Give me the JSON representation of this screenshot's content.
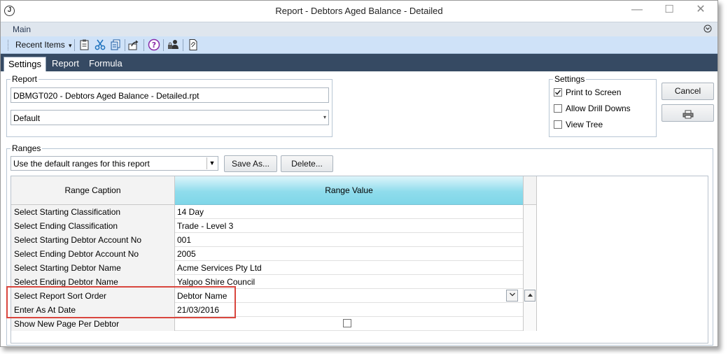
{
  "window": {
    "title": "Report - Debtors Aged Balance - Detailed",
    "app_icon_letter": "J",
    "minimize": "—",
    "maximize": "☐",
    "close": "✕"
  },
  "mainbar": {
    "label": "Main",
    "chevron": "⌄"
  },
  "toolbar": {
    "recent_label": "Recent Items",
    "recent_arrow": "▾",
    "icons": [
      "clipboard-icon",
      "cut-icon",
      "copy-icon",
      "export-icon",
      "help-icon",
      "user-lock-icon",
      "attach-icon"
    ]
  },
  "tabs": [
    {
      "label": "Settings",
      "active": true
    },
    {
      "label": "Report",
      "active": false
    },
    {
      "label": "Formula",
      "active": false
    }
  ],
  "report_group": {
    "title": "Report",
    "file": "DBMGT020 - Debtors Aged Balance - Detailed.rpt",
    "layout": "Default"
  },
  "settings_group": {
    "title": "Settings",
    "options": [
      {
        "label": "Print to Screen",
        "checked": true
      },
      {
        "label": "Allow Drill Downs",
        "checked": false
      },
      {
        "label": "View Tree",
        "checked": false
      }
    ]
  },
  "buttons": {
    "cancel": "Cancel",
    "print_icon": "printer-icon"
  },
  "ranges_group": {
    "title": "Ranges",
    "preset": "Use the default ranges for this report",
    "save_as": "Save As...",
    "delete": "Delete..."
  },
  "grid": {
    "headers": {
      "caption": "Range Caption",
      "value": "Range Value"
    },
    "rows": [
      {
        "caption": "Select Starting Classification",
        "value": "14 Day"
      },
      {
        "caption": "Select Ending Classification",
        "value": "Trade - Level 3"
      },
      {
        "caption": "Select Starting Debtor Account No",
        "value": "001"
      },
      {
        "caption": "Select Ending Debtor Account No",
        "value": "2005"
      },
      {
        "caption": "Select Starting Debtor Name",
        "value": "Acme Services Pty Ltd"
      },
      {
        "caption": "Select Ending Debtor Name",
        "value": "Yalgoo Shire Council"
      },
      {
        "caption": "Select Report Sort Order",
        "value": "Debtor Name"
      },
      {
        "caption": "Enter As At Date",
        "value": "21/03/2016"
      },
      {
        "caption": "Show New Page Per Debtor",
        "value": ""
      }
    ]
  },
  "colors": {
    "accent_tabs": "#364a63",
    "toolbar": "#cfe2f8",
    "highlight": "#d9463e",
    "header_value": "#8fdcec"
  }
}
